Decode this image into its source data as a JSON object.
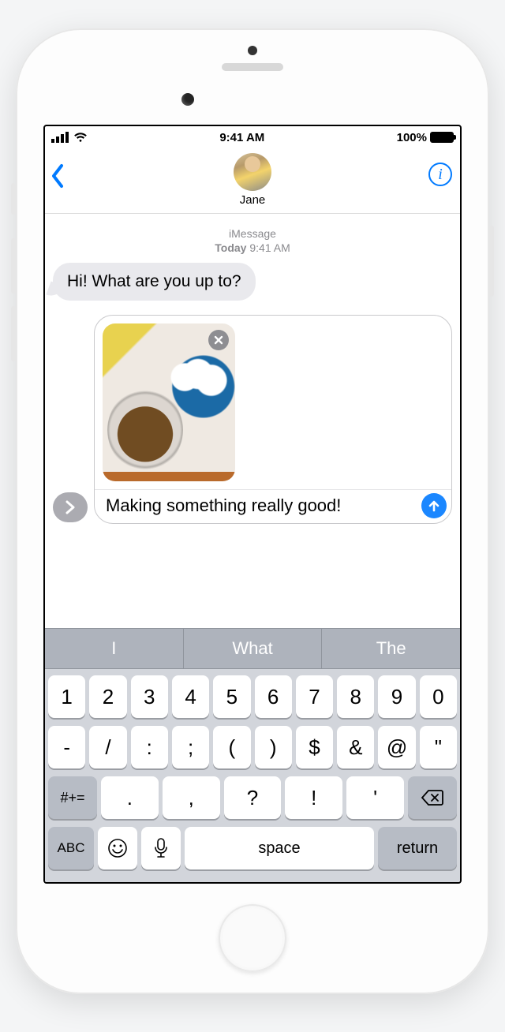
{
  "status": {
    "time": "9:41 AM",
    "battery_pct": "100%"
  },
  "nav": {
    "contact_name": "Jane"
  },
  "thread": {
    "service": "iMessage",
    "day": "Today",
    "time": "9:41 AM",
    "incoming_message": "Hi! What are you up to?"
  },
  "compose": {
    "attachment_desc": "cookie-dough-photo",
    "text_value": "Making something really good!"
  },
  "predictive": {
    "s1": "I",
    "s2": "What",
    "s3": "The"
  },
  "keyboard": {
    "row1": [
      "1",
      "2",
      "3",
      "4",
      "5",
      "6",
      "7",
      "8",
      "9",
      "0"
    ],
    "row2": [
      "-",
      "/",
      ":",
      ";",
      "(",
      ")",
      "$",
      "&",
      "@",
      "\""
    ],
    "sym_label": "#+=",
    "row3": [
      ".",
      ",",
      "?",
      "!",
      "'"
    ],
    "abc_label": "ABC",
    "space_label": "space",
    "return_label": "return"
  }
}
